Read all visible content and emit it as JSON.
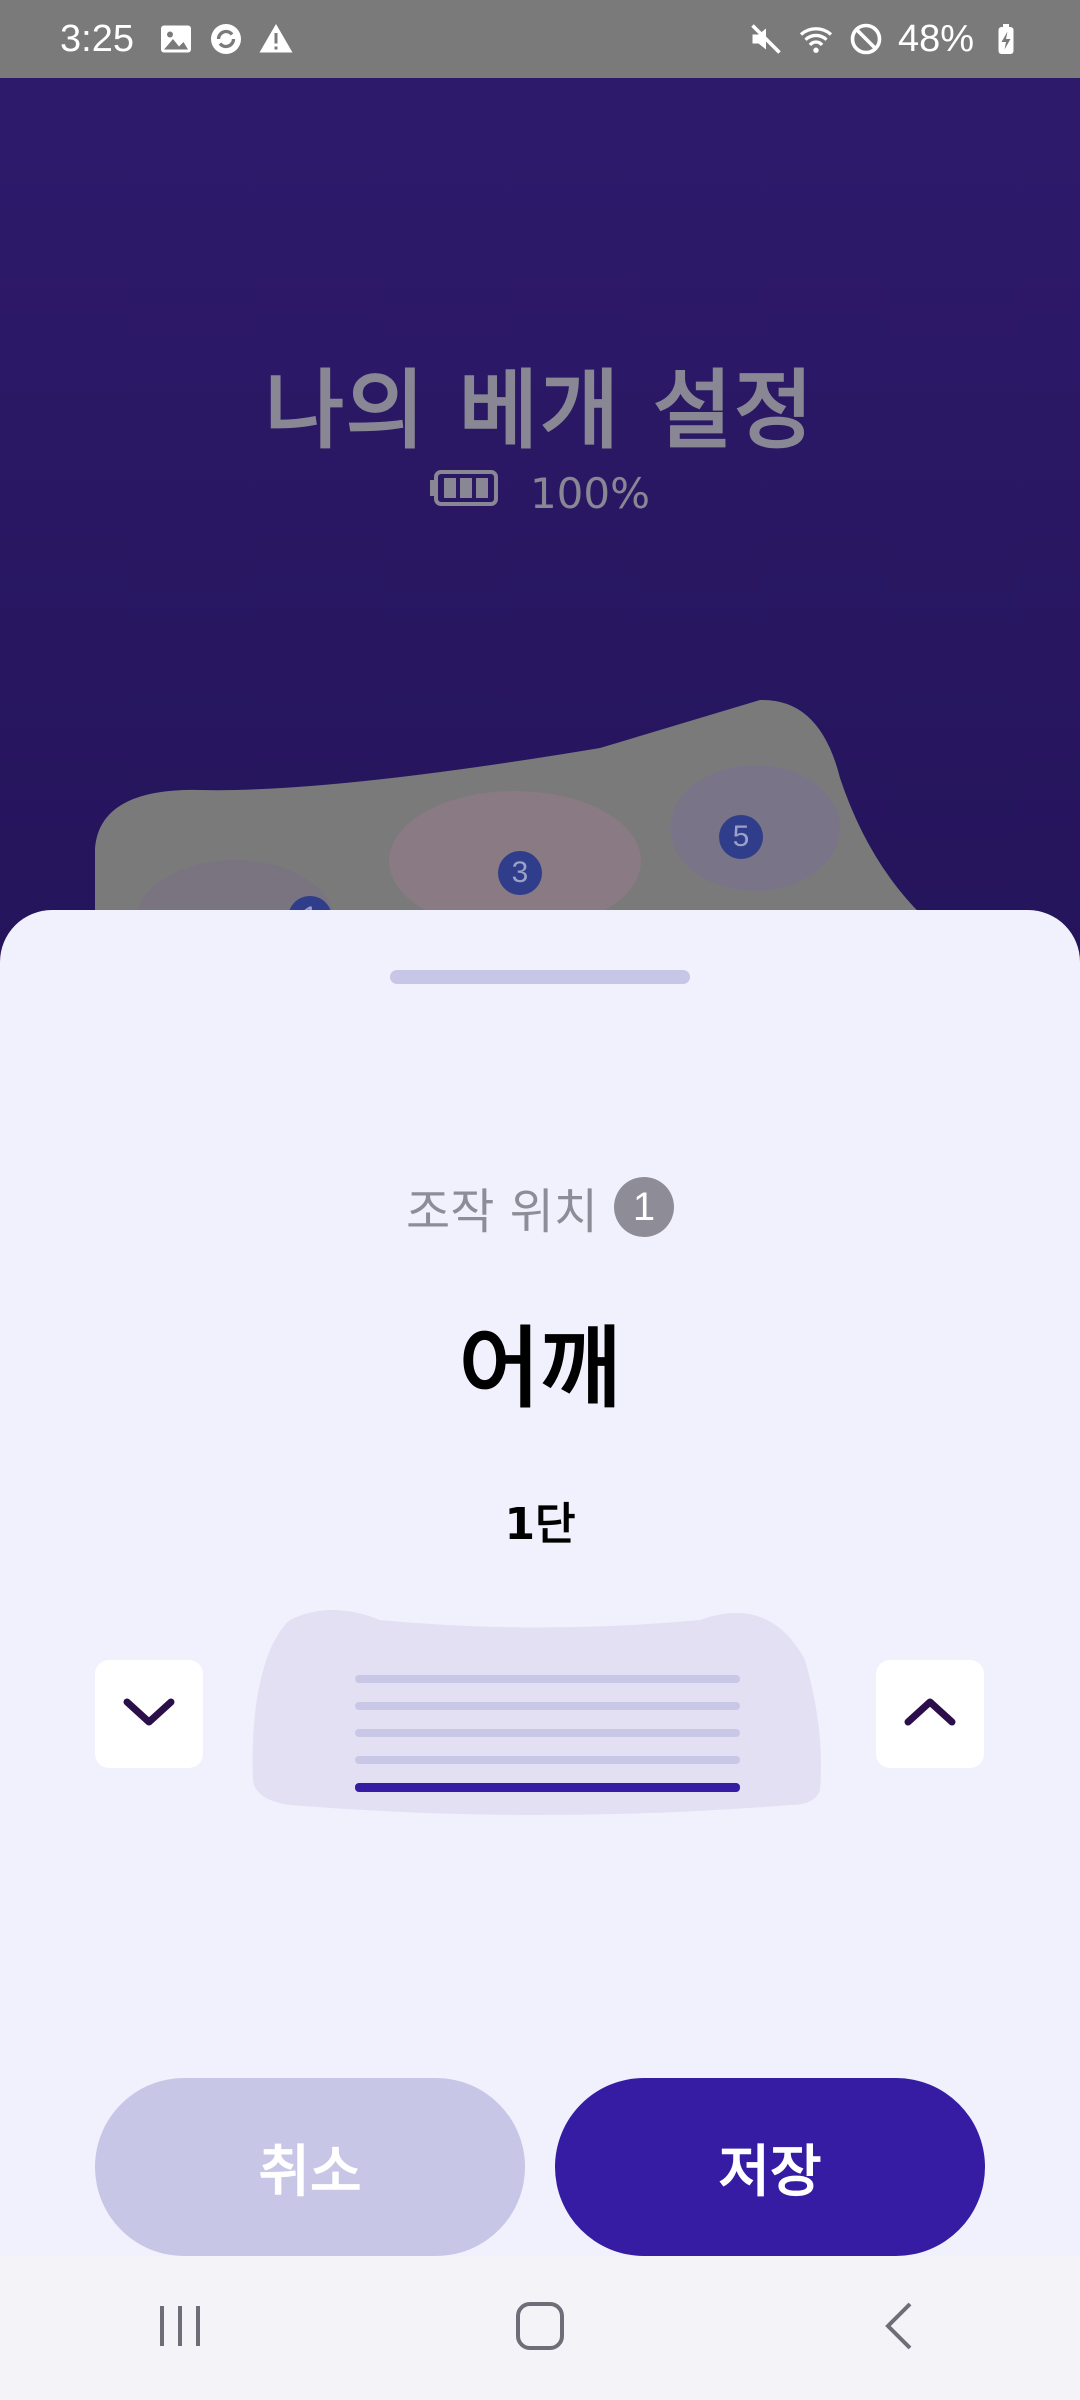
{
  "status_bar": {
    "time": "3:25",
    "battery_percent": "48%",
    "left_icons": [
      "image-icon",
      "sync-icon",
      "warning-icon"
    ],
    "right_icons": [
      "mute-icon",
      "wifi-icon",
      "do-not-disturb-icon",
      "battery-charging-icon"
    ]
  },
  "background_page": {
    "title": "나의 베개 설정",
    "battery_level": "100%",
    "zone_markers": [
      "1",
      "3",
      "5"
    ]
  },
  "sheet": {
    "location_label": "조작 위치",
    "location_number": "1",
    "body_part": "어깨",
    "level": "1단",
    "level_value": 1,
    "level_max": 5,
    "cancel_label": "취소",
    "save_label": "저장"
  },
  "colors": {
    "accent": "#351ca2",
    "sheet_background": "#f1f0fd",
    "cancel_button": "#c7c6e6"
  },
  "nav_bar": {
    "buttons": [
      "recent-apps-icon",
      "home-icon",
      "back-icon"
    ]
  }
}
